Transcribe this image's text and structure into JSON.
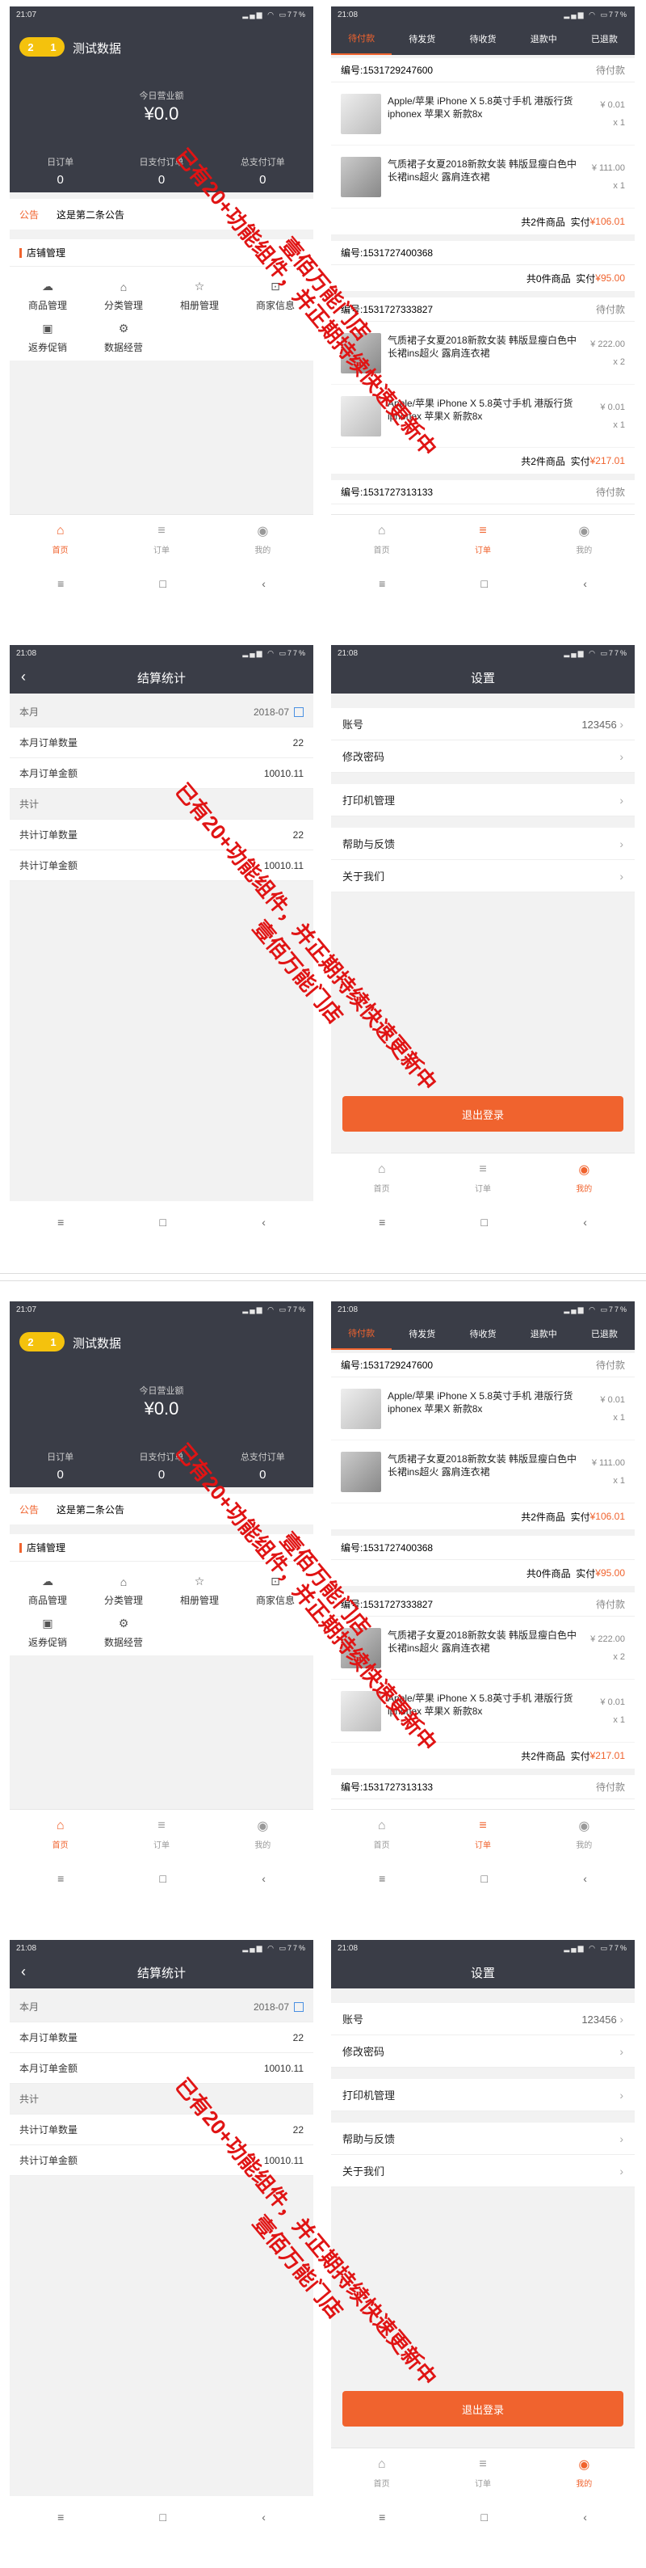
{
  "status": {
    "time_a": "21:07",
    "time_b": "21:08",
    "battery": "77%"
  },
  "home": {
    "store_pill_a": "2",
    "store_pill_b": "1",
    "store_name": "测试数据",
    "revenue_label": "今日营业额",
    "revenue_value": "¥0.0",
    "stats": [
      {
        "label": "日订单",
        "value": "0"
      },
      {
        "label": "日支付订单",
        "value": "0"
      },
      {
        "label": "总支付订单",
        "value": "0"
      }
    ],
    "notice_tag": "公告",
    "notice_text": "这是第二条公告",
    "grid_title": "店铺管理",
    "grid_items": [
      "商品管理",
      "分类管理",
      "相册管理",
      "商家信息",
      "返券促销",
      "数据经营"
    ]
  },
  "nav": [
    "首页",
    "订单",
    "我的"
  ],
  "orders": {
    "tabs": [
      "待付款",
      "待发货",
      "待收货",
      "退款中",
      "已退款"
    ],
    "list": [
      {
        "no": "编号:1531729247600",
        "status": "待付款",
        "items": [
          {
            "name": "Apple/苹果 iPhone X 5.8英寸手机 港版行货iphonex 苹果X 新款8x",
            "price": "¥ 0.01",
            "qty": "x 1",
            "kind": "phone"
          },
          {
            "name": "气质裙子女夏2018新款女装 韩版显瘦白色中长裙ins超火 露肩连衣裙",
            "price": "¥ 111.00",
            "qty": "x 1",
            "kind": "dress"
          }
        ],
        "count": "共2件商品",
        "paid_label": "实付",
        "amount": "¥106.01"
      },
      {
        "no": "编号:1531727400368",
        "status": "",
        "items": [],
        "count": "共0件商品",
        "paid_label": "实付",
        "amount": "¥95.00"
      },
      {
        "no": "编号:1531727333827",
        "status": "待付款",
        "items": [
          {
            "name": "气质裙子女夏2018新款女装 韩版显瘦白色中长裙ins超火 露肩连衣裙",
            "price": "¥ 222.00",
            "qty": "x 2",
            "kind": "dress"
          },
          {
            "name": "Apple/苹果 iPhone X 5.8英寸手机 港版行货iphonex 苹果X 新款8x",
            "price": "¥ 0.01",
            "qty": "x 1",
            "kind": "phone"
          }
        ],
        "count": "共2件商品",
        "paid_label": "实付",
        "amount": "¥217.01"
      },
      {
        "no": "编号:1531727313133",
        "status": "待付款",
        "items": [],
        "count": "",
        "paid_label": "",
        "amount": ""
      }
    ]
  },
  "settle": {
    "title": "结算统计",
    "month_head": "本月",
    "month_value": "2018-07",
    "rows_month": [
      {
        "label": "本月订单数量",
        "value": "22"
      },
      {
        "label": "本月订单金额",
        "value": "10010.11"
      }
    ],
    "total_head": "共计",
    "rows_total": [
      {
        "label": "共计订单数量",
        "value": "22"
      },
      {
        "label": "共计订单金额",
        "value": "10010.11"
      }
    ]
  },
  "settings": {
    "title": "设置",
    "account_label": "账号",
    "account_value": "123456",
    "items": [
      "修改密码",
      "打印机管理",
      "帮助与反馈",
      "关于我们"
    ],
    "logout": "退出登录"
  },
  "watermark": {
    "line1": "已有20+功能组件，并正期持续快速更新中",
    "line2": "壹佰万能门店"
  },
  "colors": {
    "accent": "#f0632e",
    "dark": "#3a3d47",
    "pill": "#f4c20d"
  }
}
